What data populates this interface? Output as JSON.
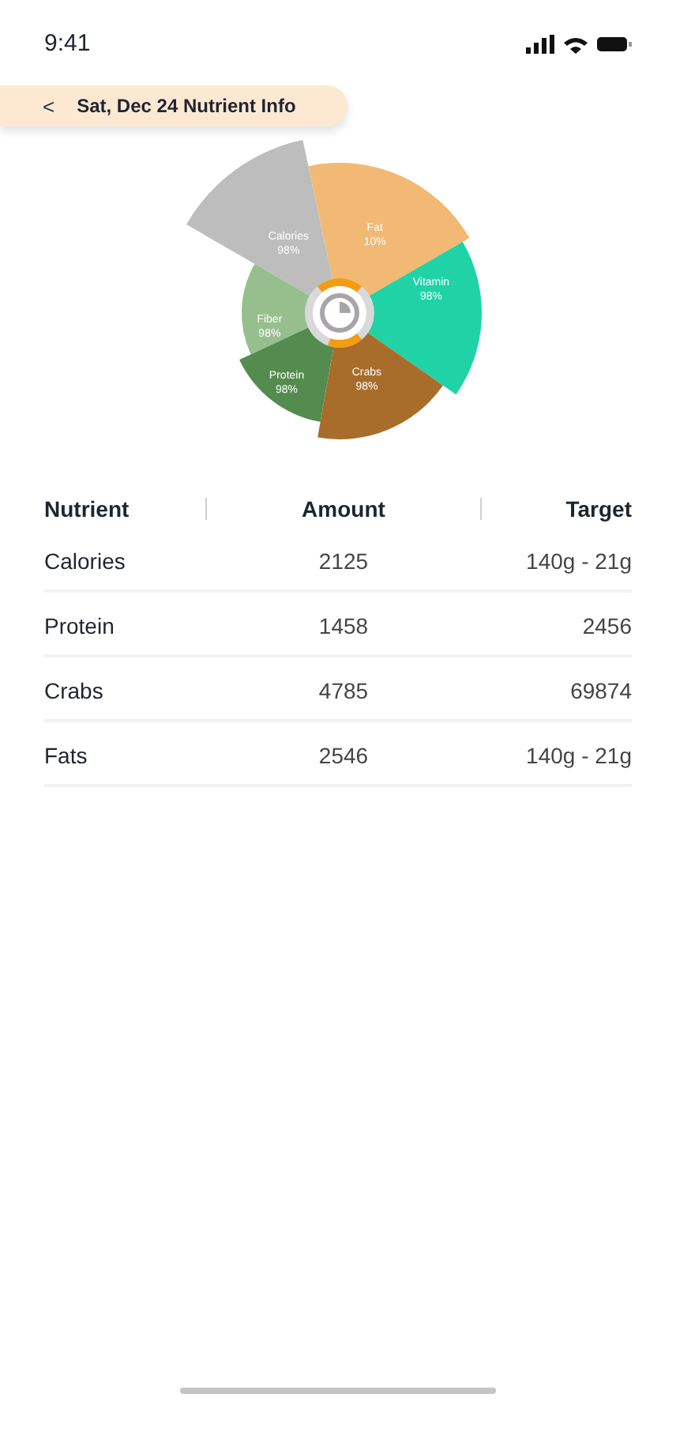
{
  "status_bar": {
    "time": "9:41"
  },
  "header": {
    "back_icon": "<",
    "title": "Sat, Dec 24 Nutrient Info"
  },
  "segments": [
    {
      "label": "Fat",
      "percent": "10%",
      "color": "#f2b974"
    },
    {
      "label": "Calories",
      "percent": "98%",
      "color": "#bdbdbd"
    },
    {
      "label": "Vitamin",
      "percent": "98%",
      "color": "#1fd3a6"
    },
    {
      "label": "Fiber",
      "percent": "98%",
      "color": "#97bf8e"
    },
    {
      "label": "Crabs",
      "percent": "98%",
      "color": "#a86d2a"
    },
    {
      "label": "Protein",
      "percent": "98%",
      "color": "#548b4e"
    }
  ],
  "table": {
    "columns": [
      "Nutrient",
      "Amount",
      "Target"
    ],
    "rows": [
      {
        "nutrient": "Calories",
        "amount": "2125",
        "target": "140g - 21g"
      },
      {
        "nutrient": "Protein",
        "amount": "1458",
        "target": "2456"
      },
      {
        "nutrient": "Crabs",
        "amount": "4785",
        "target": "69874"
      },
      {
        "nutrient": "Fats",
        "amount": "2546",
        "target": "140g - 21g"
      }
    ]
  }
}
